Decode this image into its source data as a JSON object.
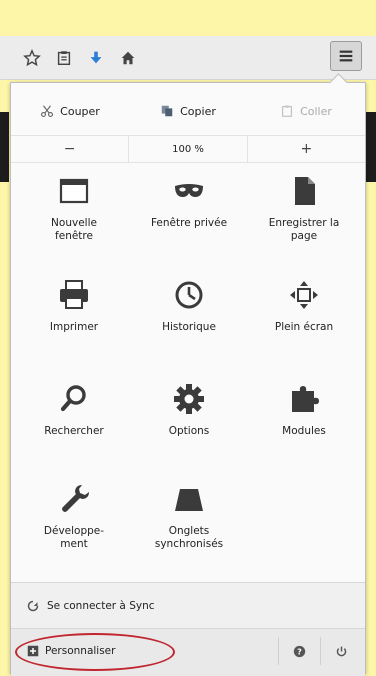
{
  "edit": {
    "cut": "Couper",
    "copy": "Copier",
    "paste": "Coller"
  },
  "zoom": {
    "minus": "−",
    "value": "100 %",
    "plus": "+"
  },
  "items": [
    {
      "label": "Nouvelle\nfenêtre",
      "icon": "new-window-icon"
    },
    {
      "label": "Fenêtre privée",
      "icon": "private-window-icon"
    },
    {
      "label": "Enregistrer la\npage",
      "icon": "save-page-icon"
    },
    {
      "label": "Imprimer",
      "icon": "print-icon"
    },
    {
      "label": "Historique",
      "icon": "history-icon"
    },
    {
      "label": "Plein écran",
      "icon": "fullscreen-icon"
    },
    {
      "label": "Rechercher",
      "icon": "search-icon"
    },
    {
      "label": "Options",
      "icon": "gear-icon"
    },
    {
      "label": "Modules",
      "icon": "puzzle-icon"
    },
    {
      "label": "Développe-\nment",
      "icon": "wrench-icon"
    },
    {
      "label": "Onglets\nsynchronisés",
      "icon": "synced-tabs-icon"
    }
  ],
  "sync": {
    "label": "Se connecter à Sync"
  },
  "footer": {
    "customize": "Personnaliser"
  },
  "colors": {
    "highlight": "#c0262f",
    "accent_blue": "#2a7fd4"
  }
}
